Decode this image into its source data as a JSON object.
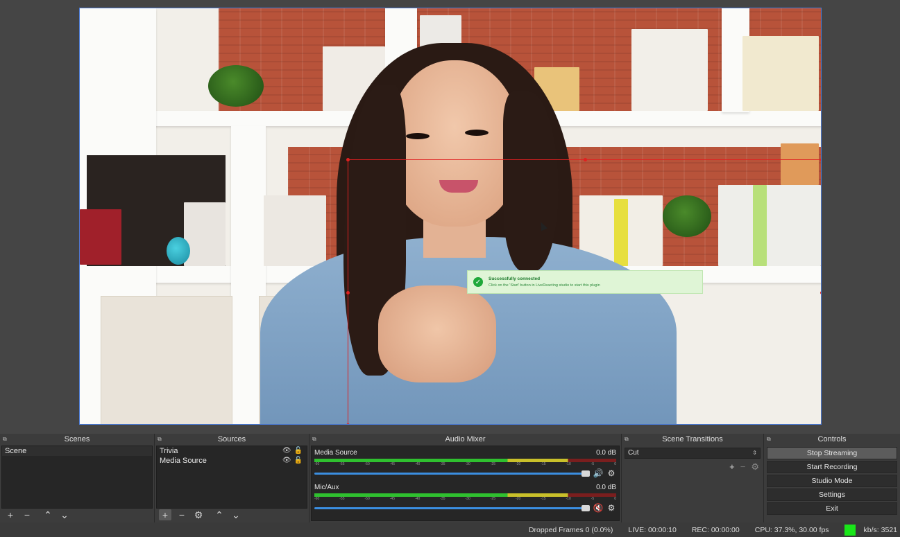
{
  "toast": {
    "title": "Successfully connected",
    "message": "Click on the 'Start' button in LiveReacting studio to start this plugin"
  },
  "docks": {
    "scenes": {
      "title": "Scenes",
      "items": [
        "Scene"
      ]
    },
    "sources": {
      "title": "Sources",
      "items": [
        "Trivia",
        "Media Source"
      ]
    },
    "mixer": {
      "title": "Audio Mixer",
      "channels": [
        {
          "name": "Media Source",
          "level": "0.0 dB",
          "muted": false
        },
        {
          "name": "Mic/Aux",
          "level": "0.0 dB",
          "muted": true
        }
      ],
      "ticks": [
        "-60",
        "-55",
        "-50",
        "-45",
        "-40",
        "-35",
        "-30",
        "-25",
        "-20",
        "-15",
        "-10",
        "-5",
        "0"
      ]
    },
    "transitions": {
      "title": "Scene Transitions",
      "selected": "Cut"
    },
    "controls": {
      "title": "Controls",
      "buttons": [
        "Stop Streaming",
        "Start Recording",
        "Studio Mode",
        "Settings",
        "Exit"
      ]
    }
  },
  "status": {
    "dropped": "Dropped Frames 0 (0.0%)",
    "live": "LIVE: 00:00:10",
    "rec": "REC: 00:00:00",
    "cpu": "CPU: 37.3%, 30.00 fps",
    "kbs": "kb/s: 3521"
  },
  "colors": {
    "accent": "#3b8ee0",
    "selection": "#e02020",
    "live": "#19e619"
  }
}
